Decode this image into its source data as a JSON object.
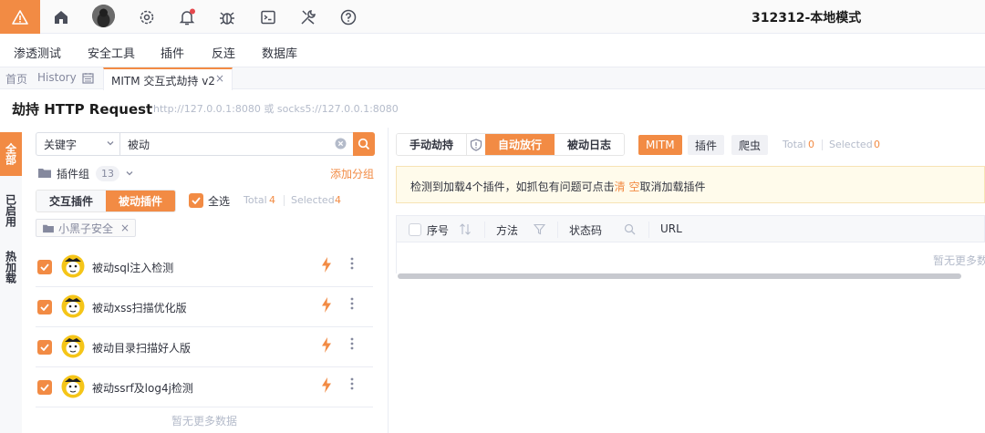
{
  "app": {
    "title": "312312-本地模式"
  },
  "topbar": {
    "icons": [
      "warning-icon",
      "home-icon",
      "avatar",
      "settings-icon",
      "bell-icon",
      "bug-icon",
      "terminal-icon",
      "tools-icon",
      "help-icon"
    ],
    "accent": "#f28b44"
  },
  "menu": {
    "items": [
      "渗透测试",
      "安全工具",
      "插件",
      "反连",
      "数据库"
    ]
  },
  "tabs": {
    "home": "首页",
    "history": "History",
    "active": "MITM 交互式劫持 v2",
    "close": "×"
  },
  "header": {
    "title": "劫持 HTTP Request",
    "proxy": "http://127.0.0.1:8080 或 socks5://127.0.0.1:8080"
  },
  "sidetabs": [
    "全部",
    "已启用",
    "热加载"
  ],
  "search": {
    "type": "关键字",
    "value": "被动"
  },
  "plugin_group": {
    "label": "插件组",
    "count": "13",
    "add": "添加分组"
  },
  "mode_buttons": {
    "interactive": "交互插件",
    "passive": "被动插件"
  },
  "select_all": {
    "label": "全选",
    "total_label": "Total",
    "total": "4",
    "selected_label": "Selected",
    "selected": "4"
  },
  "filter_tag": "小黑子安全",
  "plugins": [
    {
      "name": "被动sql注入检测"
    },
    {
      "name": "被动xss扫描优化版"
    },
    {
      "name": "被动目录扫描好人版"
    },
    {
      "name": "被动ssrf及log4j检测"
    }
  ],
  "left_empty": "暂无更多数据",
  "right": {
    "manual": "手动劫持",
    "auto": "自动放行",
    "passive_log": "被动日志",
    "tags": [
      "MITM",
      "插件",
      "爬虫"
    ],
    "total_label": "Total",
    "total": "0",
    "selected_label": "Selected",
    "selected": "0",
    "banner_pre": "检测到加载4个插件，如抓包有问题可点击",
    "banner_link": "清 空",
    "banner_post": "取消加载插件",
    "columns": [
      "序号",
      "方法",
      "状态码",
      "URL"
    ],
    "empty": "暂无更多数"
  }
}
